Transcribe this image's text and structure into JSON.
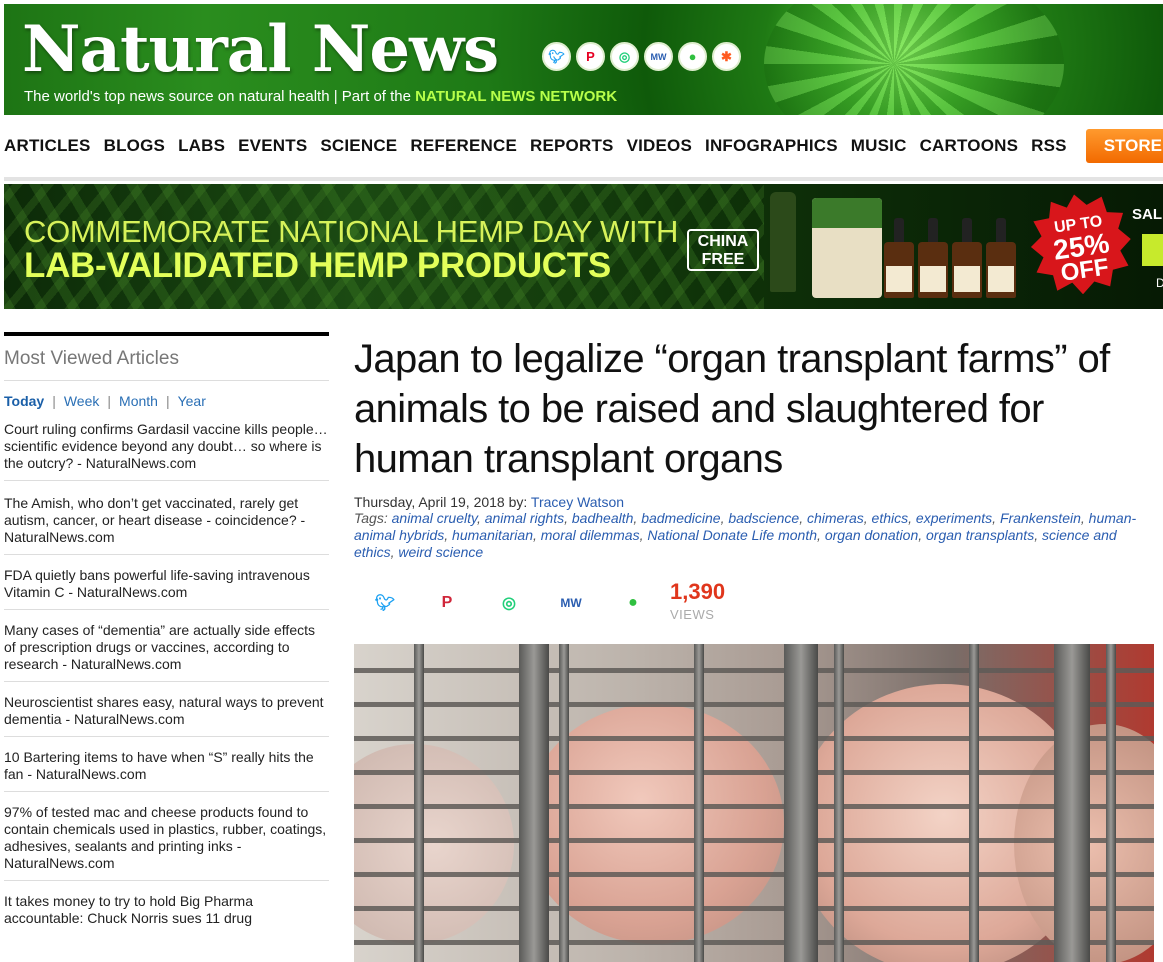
{
  "header": {
    "logo": "Natural News",
    "tagline_prefix": "The world's top news source on natural health | Part of the ",
    "tagline_network": "NATURAL NEWS NETWORK",
    "social_icons": [
      "twitter-icon",
      "pinterest-icon",
      "gab-icon",
      "mewe-icon",
      "frog-icon",
      "star-icon"
    ]
  },
  "nav": {
    "items": [
      "ARTICLES",
      "BLOGS",
      "LABS",
      "EVENTS",
      "SCIENCE",
      "REFERENCE",
      "REPORTS",
      "VIDEOS",
      "INFOGRAPHICS",
      "MUSIC",
      "CARTOONS",
      "RSS"
    ],
    "store": "STORE"
  },
  "ad": {
    "line1": "COMMEMORATE NATIONAL HEMP DAY WITH",
    "line2": "LAB-VALIDATED HEMP PRODUCTS",
    "china_free_1": "CHINA",
    "china_free_2": "FREE",
    "burst_1": "UP TO",
    "burst_2": "25%",
    "burst_3": "OFF",
    "sale": "SAL",
    "d": "D"
  },
  "sidebar": {
    "title": "Most Viewed Articles",
    "tabs": [
      "Today",
      "Week",
      "Month",
      "Year"
    ],
    "articles": [
      "Court ruling confirms Gardasil vaccine kills people… scientific evidence beyond any doubt… so where is the outcry? - NaturalNews.com",
      "The Amish, who don’t get vaccinated, rarely get autism, cancer, or heart disease - coincidence? - NaturalNews.com",
      "FDA quietly bans powerful life-saving intravenous Vitamin C - NaturalNews.com",
      "Many cases of “dementia” are actually side effects of prescription drugs or vaccines, according to research - NaturalNews.com",
      "Neuroscientist shares easy, natural ways to prevent dementia - NaturalNews.com",
      "10 Bartering items to have when “S” really hits the fan - NaturalNews.com",
      "97% of tested mac and cheese products found to contain chemicals used in plastics, rubber, coatings, adhesives, sealants and printing inks - NaturalNews.com",
      "It takes money to try to hold Big Pharma accountable: Chuck Norris sues 11 drug"
    ]
  },
  "article": {
    "title": "Japan to legalize “organ transplant farms” of animals to be raised and slaughtered for human transplant organs",
    "date": "Thursday, April 19, 2018 by: ",
    "author": "Tracey Watson",
    "tags_label": "Tags: ",
    "tags": [
      "animal cruelty",
      "animal rights",
      "badhealth",
      "badmedicine",
      "badscience",
      "chimeras",
      "ethics",
      "experiments",
      "Frankenstein",
      "human-animal hybrids",
      "humanitarian",
      "moral dilemmas",
      "National Donate Life month",
      "organ donation",
      "organ transplants",
      "science and ethics",
      "weird science"
    ],
    "share_icons": [
      "twitter-icon",
      "pinterest-icon",
      "gab-icon",
      "mewe-icon",
      "frog-icon"
    ],
    "views_count": "1,390",
    "views_label": "VIEWS"
  },
  "colors": {
    "brand_green": "#2a8d1e",
    "store_orange": "#f26a00",
    "link_blue": "#2a5db0",
    "views_red": "#e0361c"
  }
}
